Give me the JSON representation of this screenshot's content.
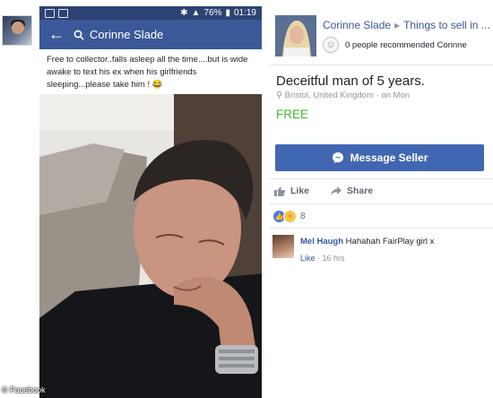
{
  "phone": {
    "status": {
      "battery": "76%",
      "time": "01:19"
    },
    "search_query": "Corinne Slade",
    "post_text": "Free to collector..falls asleep all the time....but is wide awake to text his ex when his girlfriends sleeping...please take him ! 😂"
  },
  "listing": {
    "seller_name": "Corinne Slade",
    "category": "Things to sell in ...",
    "recommendations": "0 people recommended Corinne",
    "title": "Deceitful man of 5 years.",
    "location": "Bristol, United Kingdom · on Mon",
    "price": "FREE",
    "message_button": "Message Seller",
    "like_label": "Like",
    "share_label": "Share",
    "reaction_count": "8"
  },
  "comment": {
    "author": "Mel Haugh",
    "text": "Hahahah FairPlay girl x",
    "like_label": "Like",
    "time": "16 hrs"
  },
  "credit": "© Facebook",
  "colors": {
    "brand_blue": "#3b5998",
    "button_blue": "#4267b2",
    "free_green": "#42b72a",
    "link_blue": "#365899"
  }
}
